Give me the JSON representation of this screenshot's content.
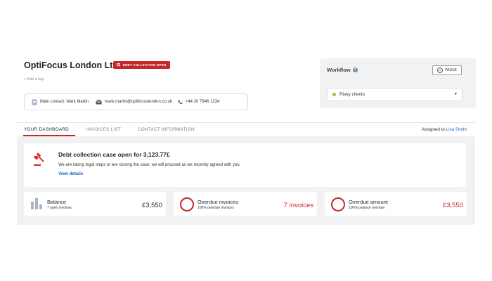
{
  "header": {
    "company_name": "OptiFocus London Ltd",
    "badge_label": "DEBT COLLECTION OPEN",
    "add_tag": "+ Add a tag"
  },
  "contact": {
    "main_contact": "Main contact: Mark Martin",
    "email": "mark.martin@optifocuslondon.co.uk",
    "phone": "+44 20 7946 1234"
  },
  "workflow": {
    "title": "Workflow",
    "pause_label": "PAUSE",
    "selected": "Risky clients",
    "status_color": "#9cc23b"
  },
  "tabs": [
    {
      "label": "YOUR DASHBOARD",
      "active": true
    },
    {
      "label": "INVOICES LIST",
      "active": false
    },
    {
      "label": "CONTACT INFORMATION",
      "active": false
    }
  ],
  "assigned": {
    "prefix": "Assigned to",
    "name": "Lisa Smith"
  },
  "alert": {
    "title": "Debt collection case open for 3,123.77£",
    "text": "We are taking legal steps or are closing the case: we will proceed as we recently agreed with you.",
    "link": "View details"
  },
  "stats": {
    "balance": {
      "label": "Balance",
      "sub": "7 open invoices",
      "value": "£3,550"
    },
    "overdue_invoices": {
      "label": "Overdue invoices",
      "sub": "100% overdue invoices",
      "value": "7 invoices"
    },
    "overdue_amount": {
      "label": "Overdue amount",
      "sub": "100% balance overdue",
      "value": "£3,550"
    }
  },
  "colors": {
    "accent_red": "#c62828",
    "link_blue": "#1565c0",
    "panel_grey": "#f1f2f3"
  }
}
